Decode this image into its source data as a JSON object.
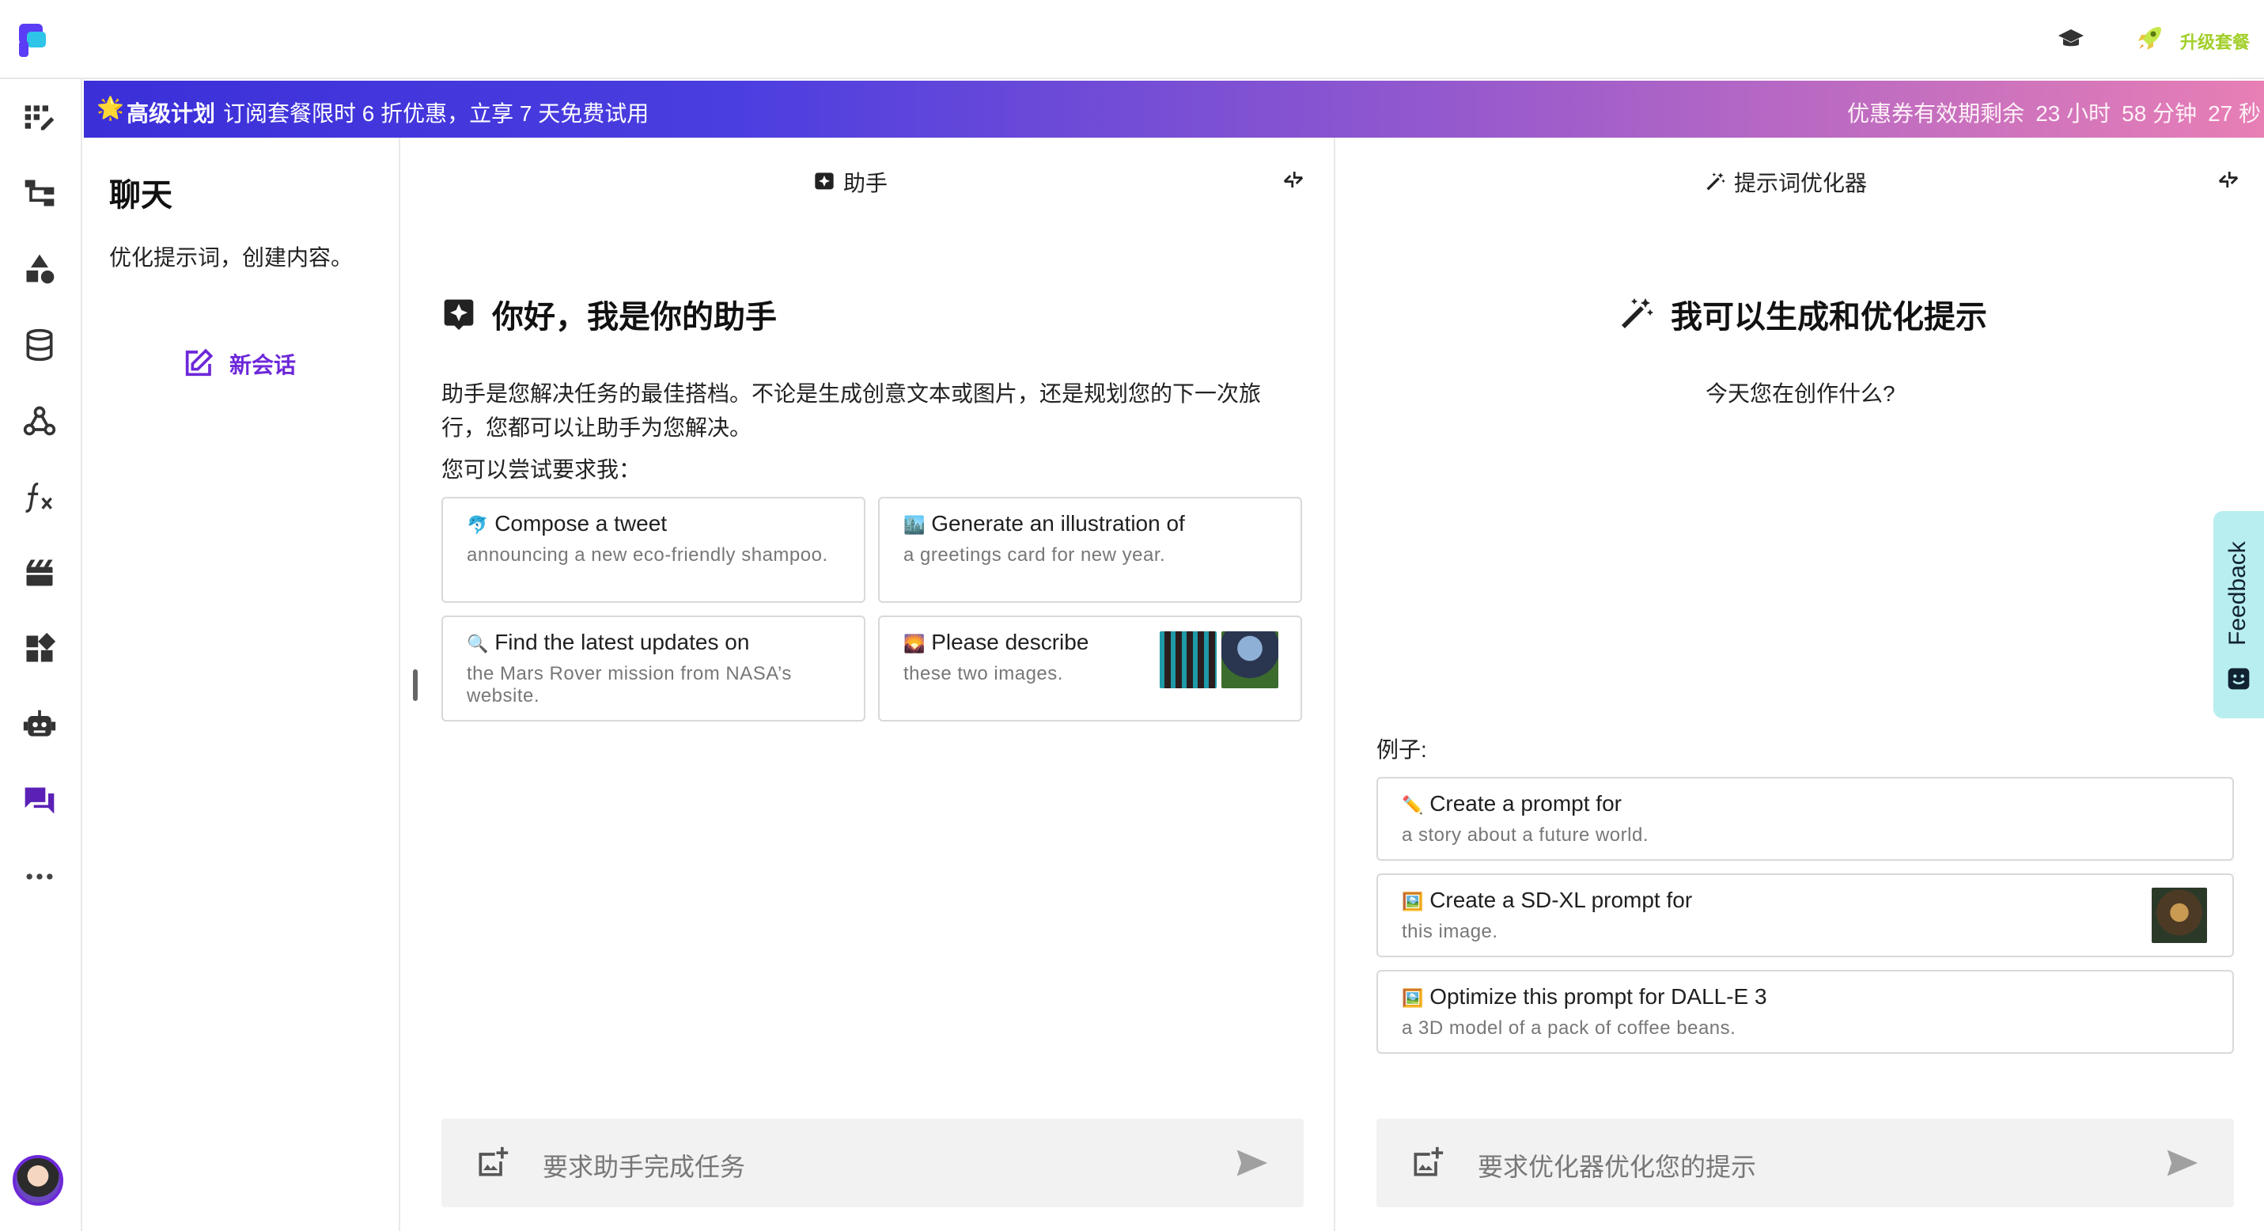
{
  "header": {
    "upgrade_label": "升级套餐"
  },
  "banner": {
    "star": "🌟",
    "plan": "高级计划",
    "text": "订阅套餐限时 6 折优惠，立享 7 天免费试用",
    "countdown_label": "优惠券有效期剩余",
    "hours": "23 小时",
    "minutes": "58 分钟",
    "seconds": "27 秒"
  },
  "sidebar": {
    "items": [
      {
        "icon": "dashboard-icon"
      },
      {
        "icon": "workflow-icon"
      },
      {
        "icon": "shapes-icon"
      },
      {
        "icon": "database-icon"
      },
      {
        "icon": "webhook-icon"
      },
      {
        "icon": "function-icon"
      },
      {
        "icon": "film-icon"
      },
      {
        "icon": "widgets-icon"
      },
      {
        "icon": "robot-icon"
      },
      {
        "icon": "chat-icon",
        "active": true
      },
      {
        "icon": "more-icon"
      }
    ]
  },
  "chat_panel": {
    "title": "聊天",
    "subtitle": "优化提示词，创建内容。",
    "new_chat": "新会话"
  },
  "assistant": {
    "header": "助手",
    "heading": "你好，我是你的助手",
    "description": "助手是您解决任务的最佳搭档。不论是生成创意文本或图片，还是规划您的下一次旅行，您都可以让助手为您解决。",
    "try_label": "您可以尝试要求我：",
    "cards": [
      {
        "emoji": "🐬",
        "title": "Compose a tweet",
        "subtitle": "announcing a new eco-friendly shampoo."
      },
      {
        "emoji": "🏙️",
        "title": "Generate an illustration of",
        "subtitle": "a greetings card for new year."
      },
      {
        "emoji": "🔍",
        "title": "Find the latest updates on",
        "subtitle": "the Mars Rover mission from NASA’s website."
      },
      {
        "emoji": "🌄",
        "title": "Please describe",
        "subtitle": "these two images."
      }
    ],
    "input_placeholder": "要求助手完成任务"
  },
  "optimizer": {
    "header": "提示词优化器",
    "heading": "我可以生成和优化提示",
    "subtitle": "今天您在创作什么?",
    "examples_label": "例子:",
    "examples": [
      {
        "emoji": "✏️",
        "title": "Create a prompt for",
        "subtitle": "a story about a future world."
      },
      {
        "emoji": "🖼️",
        "title": "Create a SD-XL prompt for",
        "subtitle": "this image."
      },
      {
        "emoji": "🖼️",
        "title": "Optimize this prompt for DALL-E 3",
        "subtitle": "a 3D model of a pack of coffee beans."
      }
    ],
    "input_placeholder": "要求优化器优化您的提示"
  },
  "feedback": {
    "label": "Feedback"
  },
  "colors": {
    "accent": "#6d28d9",
    "banner_start": "#3b2fd8",
    "banner_end": "#e87fb5",
    "upgrade": "#a3cf2a",
    "feedback_bg": "#b8eef0"
  }
}
